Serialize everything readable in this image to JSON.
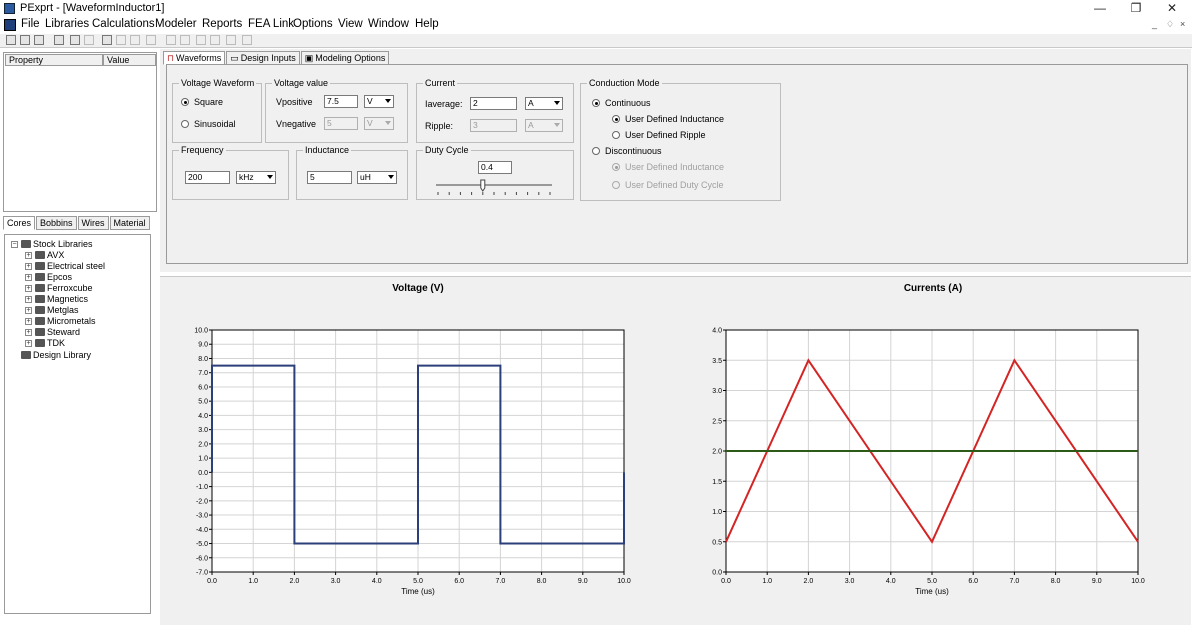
{
  "window": {
    "title": "PExprt - [WaveformInductor1]",
    "minimize": "—",
    "restore": "❐",
    "close": "✕"
  },
  "menu": [
    "File",
    "Libraries",
    "Calculations",
    "Modeler",
    "Reports",
    "FEA Link",
    "Options",
    "View",
    "Window",
    "Help"
  ],
  "mdi_controls": {
    "min": "_",
    "restore": "♢",
    "close": "×"
  },
  "property_grid": {
    "col_property": "Property",
    "col_value": "Value"
  },
  "library_tabs": [
    "Cores",
    "Bobbins",
    "Wires",
    "Material"
  ],
  "tree": {
    "root": "Stock Libraries",
    "children": [
      "AVX",
      "Electrical steel",
      "Epcos",
      "Ferroxcube",
      "Magnetics",
      "Metglas",
      "Micrometals",
      "Steward",
      "TDK"
    ],
    "design": "Design Library"
  },
  "main_tabs": [
    "Waveforms",
    "Design Inputs",
    "Modeling Options"
  ],
  "voltage_waveform": {
    "label": "Voltage Waveform",
    "square": "Square",
    "sinusoidal": "Sinusoidal",
    "selected": "Square"
  },
  "voltage_value": {
    "label": "Voltage value",
    "vpos_label": "Vpositive",
    "vpos": "7.5",
    "vpos_unit": "V",
    "vneg_label": "Vnegative",
    "vneg": "5",
    "vneg_unit": "V"
  },
  "current": {
    "label": "Current",
    "iavg_label": "Iaverage:",
    "iavg": "2",
    "iavg_unit": "A",
    "ripple_label": "Ripple:",
    "ripple": "3",
    "ripple_unit": "A"
  },
  "conduction": {
    "label": "Conduction Mode",
    "continuous": "Continuous",
    "udi": "User Defined Inductance",
    "udr": "User Defined Ripple",
    "discontinuous": "Discontinuous",
    "d_udi": "User Defined Inductance",
    "d_udd": "User Defined Duty Cycle"
  },
  "frequency": {
    "label": "Frequency",
    "value": "200",
    "unit": "kHz"
  },
  "inductance": {
    "label": "Inductance",
    "value": "5",
    "unit": "uH"
  },
  "duty": {
    "label": "Duty Cycle",
    "value": "0.4",
    "fraction": 0.4
  },
  "colors": {
    "voltage": "#2b3f7a",
    "current_ramp": "#d42424",
    "current_avg": "#2e5a18"
  },
  "chart_data": [
    {
      "type": "line",
      "title": "Voltage (V)",
      "xlabel": "Time (us)",
      "ylabel": "",
      "xlim": [
        0,
        10
      ],
      "ylim": [
        -7,
        10
      ],
      "xticks": [
        "0.0",
        "1.0",
        "2.0",
        "3.0",
        "4.0",
        "5.0",
        "6.0",
        "7.0",
        "8.0",
        "9.0",
        "10.0"
      ],
      "yticks": [
        "-7.0",
        "-6.0",
        "-5.0",
        "-4.0",
        "-3.0",
        "-2.0",
        "-1.0",
        "0.0",
        "1.0",
        "2.0",
        "3.0",
        "4.0",
        "5.0",
        "6.0",
        "7.0",
        "8.0",
        "9.0",
        "10.0"
      ],
      "grid": true,
      "series": [
        {
          "x": [
            0,
            0,
            2,
            2,
            5,
            5,
            7,
            7,
            10,
            10
          ],
          "y": [
            0,
            7.5,
            7.5,
            -5,
            -5,
            7.5,
            7.5,
            -5,
            -5,
            0
          ]
        }
      ]
    },
    {
      "type": "line",
      "title": "Currents (A)",
      "xlabel": "Time (us)",
      "ylabel": "",
      "xlim": [
        0,
        10
      ],
      "ylim": [
        0,
        4
      ],
      "xticks": [
        "0.0",
        "1.0",
        "2.0",
        "3.0",
        "4.0",
        "5.0",
        "6.0",
        "7.0",
        "8.0",
        "9.0",
        "10.0"
      ],
      "yticks": [
        "0.0",
        "0.5",
        "1.0",
        "1.5",
        "2.0",
        "2.5",
        "3.0",
        "3.5",
        "4.0"
      ],
      "grid": true,
      "series": [
        {
          "x": [
            0,
            2,
            5,
            7,
            10
          ],
          "y": [
            0.5,
            3.5,
            0.5,
            3.5,
            0.5
          ]
        },
        {
          "x": [
            0,
            10
          ],
          "y": [
            2,
            2
          ]
        }
      ]
    }
  ]
}
